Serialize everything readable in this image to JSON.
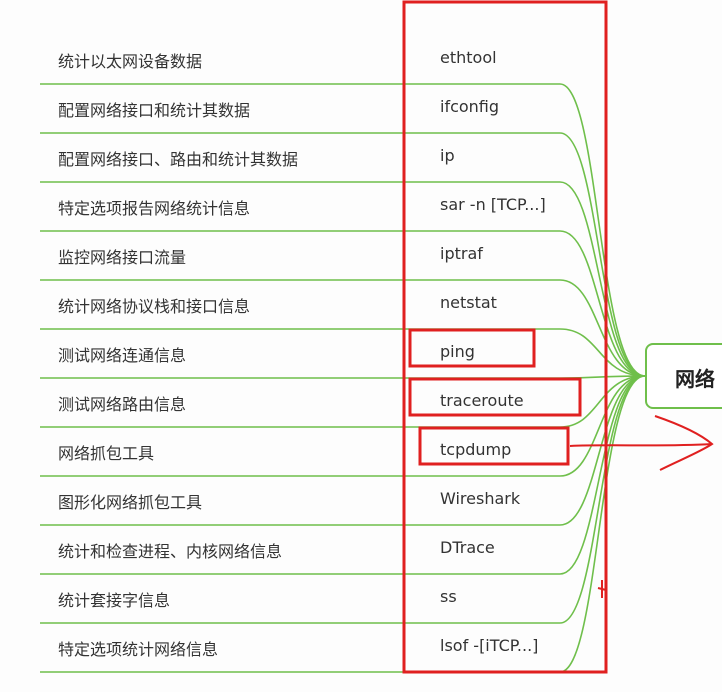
{
  "mindmap": {
    "root_label": "网络",
    "items": [
      {
        "desc": "统计以太网设备数据",
        "cmd": "ethtool"
      },
      {
        "desc": "配置网络接口和统计其数据",
        "cmd": "ifconfig"
      },
      {
        "desc": "配置网络接口、路由和统计其数据",
        "cmd": "ip"
      },
      {
        "desc": "特定选项报告网络统计信息",
        "cmd": "sar -n [TCP...]"
      },
      {
        "desc": "监控网络接口流量",
        "cmd": "iptraf"
      },
      {
        "desc": "统计网络协议栈和接口信息",
        "cmd": "netstat"
      },
      {
        "desc": "测试网络连通信息",
        "cmd": "ping"
      },
      {
        "desc": "测试网络路由信息",
        "cmd": "traceroute"
      },
      {
        "desc": "网络抓包工具",
        "cmd": "tcpdump"
      },
      {
        "desc": "图形化网络抓包工具",
        "cmd": "Wireshark"
      },
      {
        "desc": "统计和检查进程、内核网络信息",
        "cmd": "DTrace"
      },
      {
        "desc": "统计套接字信息",
        "cmd": "ss"
      },
      {
        "desc": "特定选项统计网络信息",
        "cmd": "lsof -[iTCP...]"
      }
    ],
    "highlighted_cmds": [
      "ping",
      "traceroute",
      "tcpdump"
    ]
  },
  "colors": {
    "branch_line": "#6fbf4b",
    "annotation_red": "#e02020",
    "text": "#333333"
  }
}
